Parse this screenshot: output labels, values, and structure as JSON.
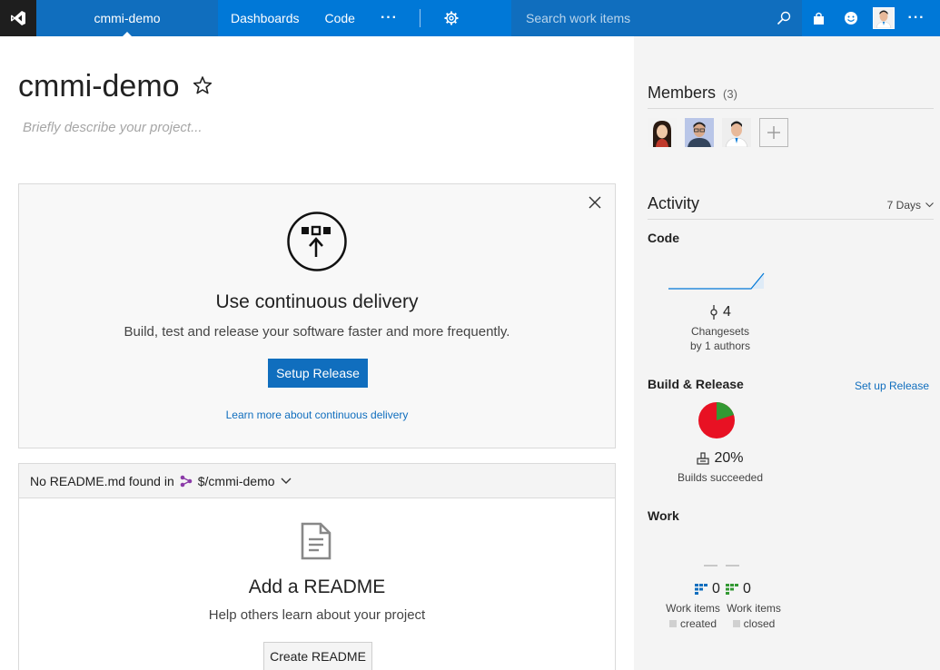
{
  "topbar": {
    "logo_icon": "visual-studio-logo-icon",
    "project": "cmmi-demo",
    "nav": [
      "Dashboards",
      "Code"
    ],
    "more_glyph": "···",
    "settings_icon": "gear-icon",
    "search_placeholder": "Search work items",
    "right_icons": [
      "search-icon",
      "marketplace-bag-icon",
      "feedback-smiley-icon",
      "user-avatar",
      "more-icon"
    ],
    "accent_color": "#0078d7"
  },
  "main": {
    "title": "cmmi-demo",
    "description_placeholder": "Briefly describe your project...",
    "cd_card": {
      "title": "Use continuous delivery",
      "subtitle": "Build, test and release your software faster and more frequently.",
      "button": "Setup Release",
      "link": "Learn more about continuous delivery"
    },
    "readme": {
      "header_prefix": "No README.md found in",
      "repo": "$/cmmi-demo",
      "title": "Add a README",
      "subtitle": "Help others learn about your project",
      "button": "Create README"
    }
  },
  "right": {
    "members_title": "Members",
    "members_count": "(3)",
    "activity_title": "Activity",
    "period": "7 Days",
    "code": {
      "title": "Code",
      "changesets": "4",
      "label1": "Changesets",
      "label2": "by 1 authors"
    },
    "build": {
      "title": "Build & Release",
      "link": "Set up Release",
      "percent": "20%",
      "label": "Builds succeeded",
      "success_fraction": 0.2,
      "success_color": "#339933",
      "fail_color": "#e81123"
    },
    "work": {
      "title": "Work",
      "created_count": "0",
      "closed_count": "0",
      "label": "Work items",
      "created": "created",
      "closed": "closed"
    }
  }
}
